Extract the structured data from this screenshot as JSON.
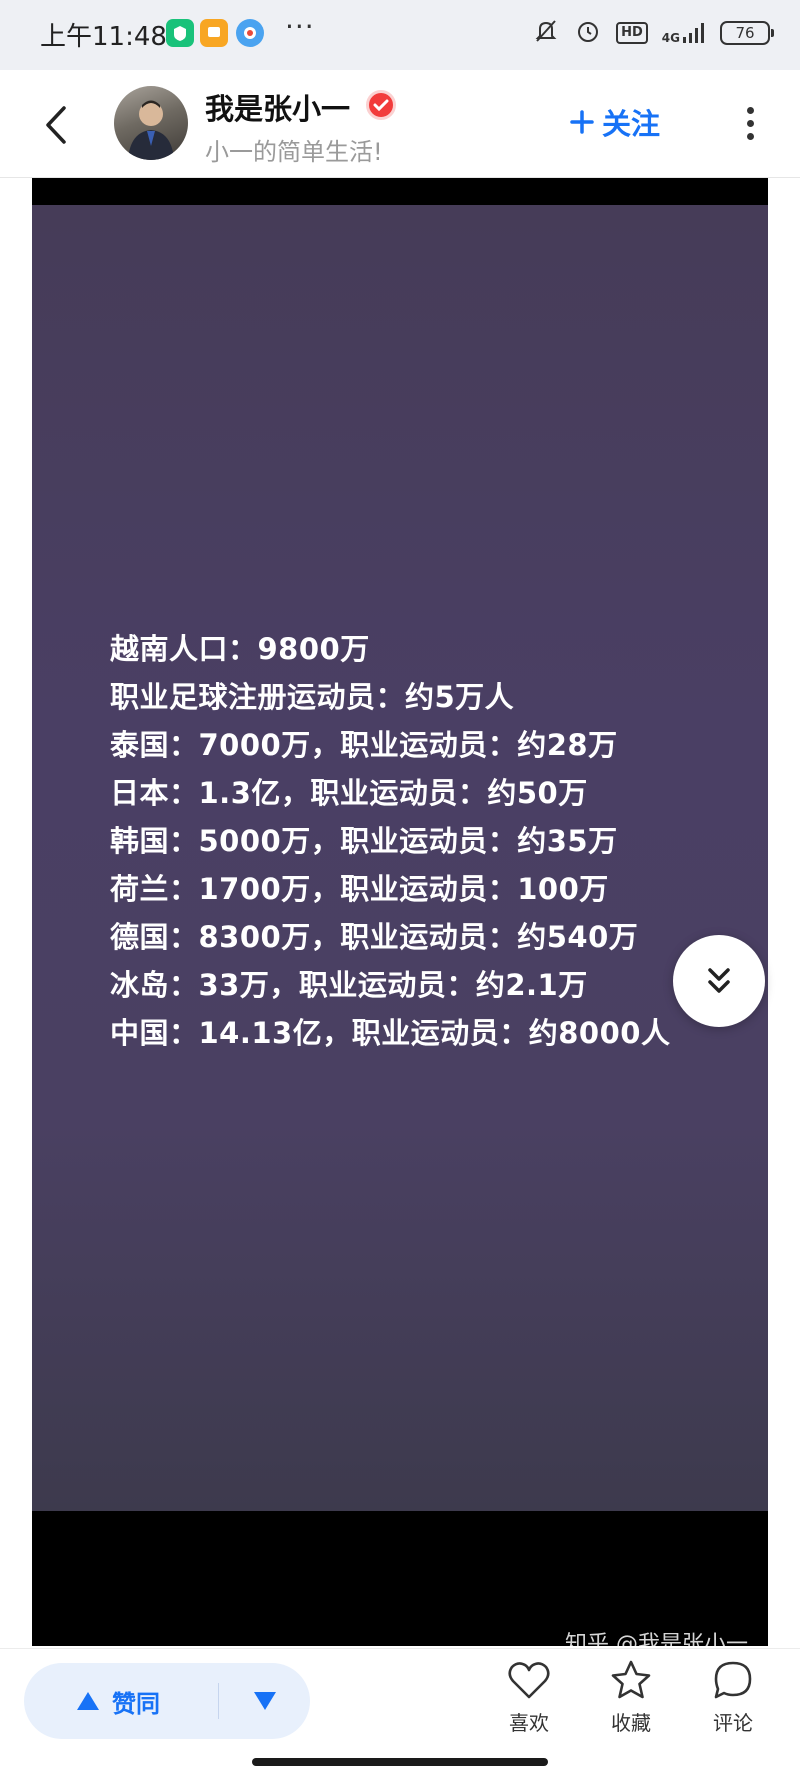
{
  "status_bar": {
    "time": "上午11:48",
    "more": "···",
    "hd": "HD",
    "network": "4G",
    "battery": "76"
  },
  "header": {
    "author_name": "我是张小一",
    "author_bio": "小一的简单生活!",
    "follow_label": "关注"
  },
  "video": {
    "lines": [
      "越南人口：9800万",
      "职业足球注册运动员：约5万人",
      "泰国：7000万，职业运动员：约28万",
      "日本：1.3亿，职业运动员：约50万",
      "韩国：5000万，职业运动员：约35万",
      "荷兰：1700万，职业运动员：100万",
      "德国：8300万，职业运动员：约540万",
      "冰岛：33万，职业运动员：约2.1万",
      "中国：14.13亿，职业运动员：约8000人"
    ],
    "watermark": "知乎 @我是张小一"
  },
  "bottom_bar": {
    "upvote_label": "赞同",
    "like_label": "喜欢",
    "favorite_label": "收藏",
    "comment_label": "评论"
  },
  "colors": {
    "accent": "#1772f6",
    "video_bg": "#4a3f64",
    "verified": "#f23b3b"
  }
}
